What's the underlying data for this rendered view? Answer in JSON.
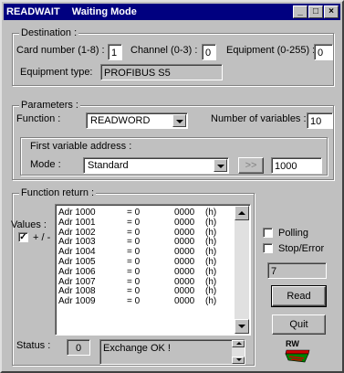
{
  "window": {
    "app_name": "READWAIT",
    "title": "Waiting Mode",
    "minimize_glyph": "_",
    "maximize_glyph": "□",
    "close_glyph": "×"
  },
  "destination": {
    "group_label": "Destination :",
    "card_label": "Card number (1-8) :",
    "card_value": "1",
    "channel_label": "Channel (0-3) :",
    "channel_value": "0",
    "equipment_label": "Equipment (0-255) :",
    "equipment_value": "0",
    "equipment_type_label": "Equipment type:",
    "equipment_type_value": "PROFIBUS S5"
  },
  "parameters": {
    "group_label": "Parameters :",
    "function_label": "Function :",
    "function_value": "READWORD",
    "num_vars_label": "Number of variables :",
    "num_vars_value": "10",
    "first_var_label": "First variable address :",
    "mode_label": "Mode :",
    "mode_value": "Standard",
    "ellipsis_label": ">>",
    "address_value": "1000"
  },
  "function_return": {
    "group_label": "Function return :",
    "values_label": "Values :",
    "plusminus_label": "+ / -",
    "plusminus_checked": "✓",
    "rows": [
      {
        "name": "Adr 1000",
        "eq": "= 0",
        "val": "0000",
        "unit": "(h)"
      },
      {
        "name": "Adr 1001",
        "eq": "= 0",
        "val": "0000",
        "unit": "(h)"
      },
      {
        "name": "Adr 1002",
        "eq": "= 0",
        "val": "0000",
        "unit": "(h)"
      },
      {
        "name": "Adr 1003",
        "eq": "= 0",
        "val": "0000",
        "unit": "(h)"
      },
      {
        "name": "Adr 1004",
        "eq": "= 0",
        "val": "0000",
        "unit": "(h)"
      },
      {
        "name": "Adr 1005",
        "eq": "= 0",
        "val": "0000",
        "unit": "(h)"
      },
      {
        "name": "Adr 1006",
        "eq": "= 0",
        "val": "0000",
        "unit": "(h)"
      },
      {
        "name": "Adr 1007",
        "eq": "= 0",
        "val": "0000",
        "unit": "(h)"
      },
      {
        "name": "Adr 1008",
        "eq": "= 0",
        "val": "0000",
        "unit": "(h)"
      },
      {
        "name": "Adr 1009",
        "eq": "= 0",
        "val": "0000",
        "unit": "(h)"
      }
    ],
    "status_label": "Status :",
    "status_code": "0",
    "status_message": "Exchange OK !"
  },
  "side": {
    "polling_label": "Polling",
    "stop_error_label": "Stop/Error",
    "counter_value": "7",
    "read_label": "Read",
    "quit_label": "Quit",
    "logo_text": "RW"
  },
  "colors": {
    "titlebar": "#000080",
    "face": "#c0c0c0",
    "logo_red": "#cc0000",
    "logo_green": "#008000"
  }
}
